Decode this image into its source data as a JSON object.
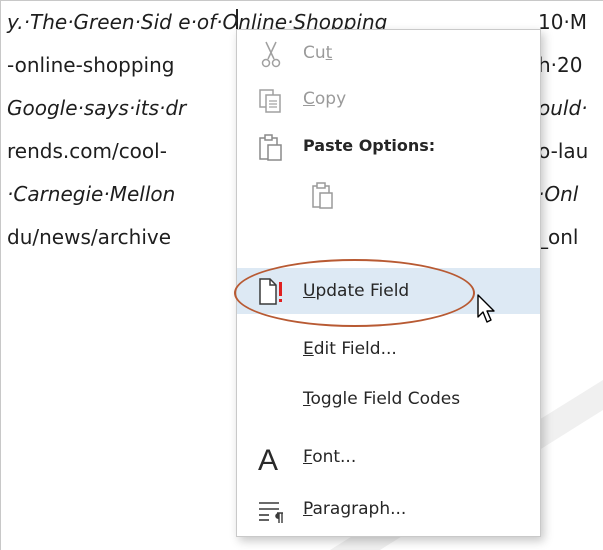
{
  "document": {
    "lines": [
      {
        "left": "y.·The·Green·Sid",
        "right": "10·M",
        "italic_left": true
      },
      {
        "left": "-online-shopping",
        "right": "h·20",
        "italic_left": false
      },
      {
        "left": "Google·says·its·dr",
        "right": "ould·",
        "italic_left": true
      },
      {
        "left": "rends.com/cool-",
        "right": "o-lau",
        "italic_left": false
      },
      {
        "left": "·Carnegie·Mellon",
        "right": "·Onl",
        "italic_left": true
      },
      {
        "left": "du/news/archive",
        "right": "_onl",
        "italic_left": false
      }
    ],
    "hidden_fragment": "e·of·Online·Shopping"
  },
  "context_menu": {
    "cut": {
      "pre": "Cu",
      "acc": "t",
      "post": ""
    },
    "copy": {
      "pre": "",
      "acc": "C",
      "post": "opy"
    },
    "paste_options": "Paste Options:",
    "update_field": {
      "pre": "",
      "acc": "U",
      "post": "pdate Field"
    },
    "edit_field": {
      "pre": "",
      "acc": "E",
      "post": "dit Field..."
    },
    "toggle_field_codes": {
      "pre": "",
      "acc": "T",
      "post": "oggle Field Codes"
    },
    "font": {
      "pre": "",
      "acc": "F",
      "post": "ont..."
    },
    "paragraph": {
      "pre": "",
      "acc": "P",
      "post": "aragraph..."
    }
  },
  "icons": {
    "cut": "scissors-icon",
    "copy": "copy-icon",
    "paste": "clipboard-icon",
    "paste_keep_text": "paste-keep-text-only-icon",
    "update_field": "update-field-icon",
    "font": "font-icon",
    "paragraph": "paragraph-icon"
  },
  "colors": {
    "hover": "#dde9f4",
    "callout": "#b85a33",
    "update_icon_accent": "#e02020",
    "disabled_text": "#9a9a9a"
  }
}
